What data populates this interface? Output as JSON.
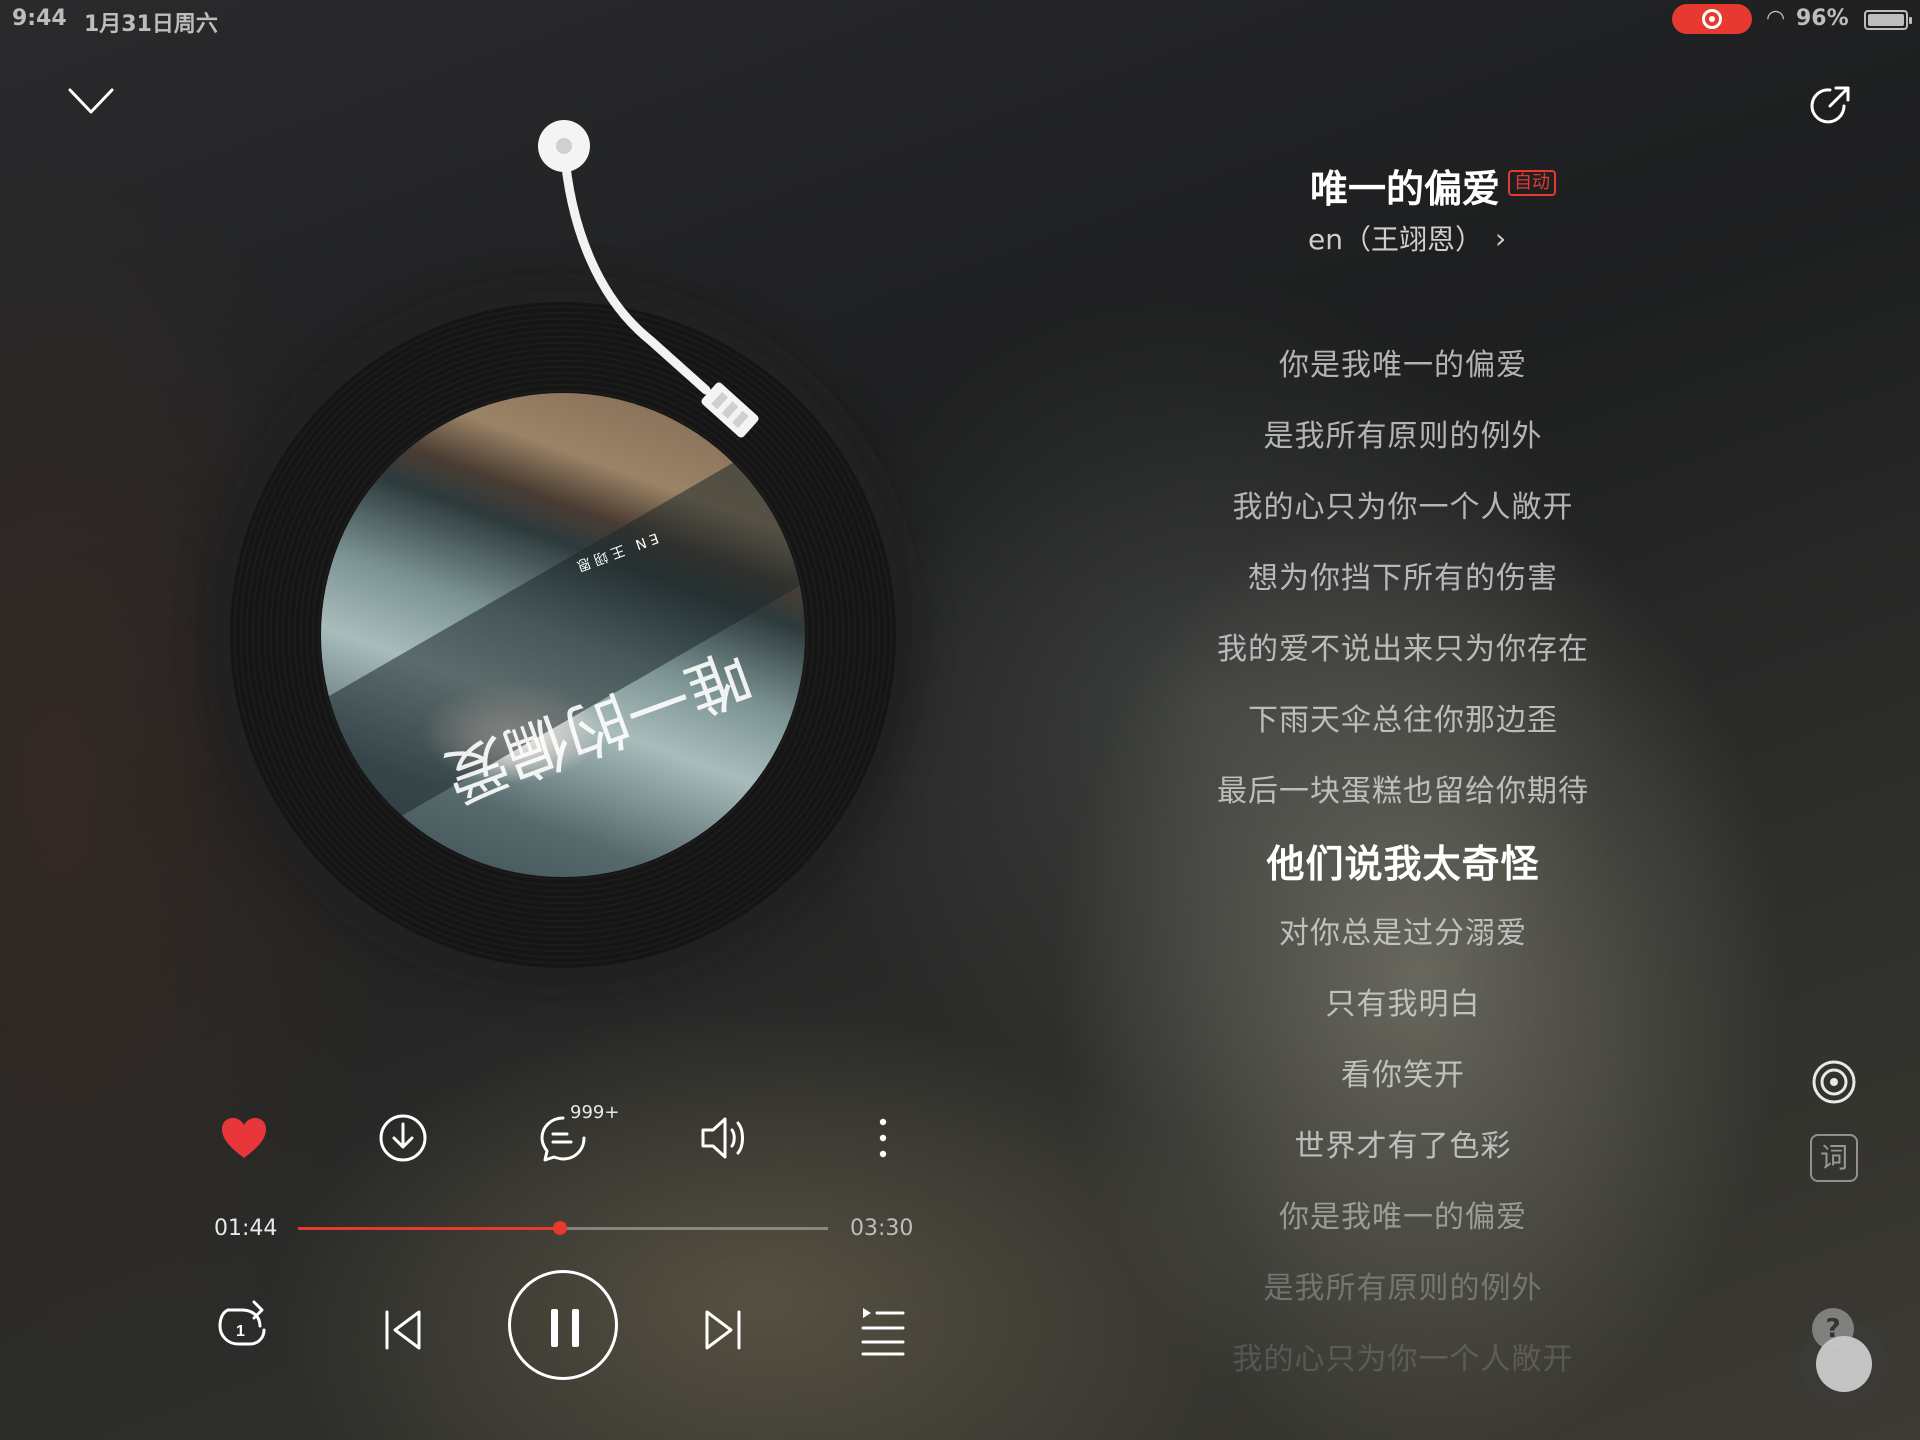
{
  "status_bar": {
    "time": "9:44",
    "date": "1月31日周六",
    "battery": "96%",
    "record_color": "#e63a30"
  },
  "song": {
    "title": "唯一的偏爱",
    "badge": "自动",
    "artist": "en（王翊恩）",
    "chevron": "›"
  },
  "album_art": {
    "title_text": "唯一的偏爱",
    "small_text": "EN 王翊恩"
  },
  "actions": {
    "comment_count": "999+",
    "liked": true,
    "like_color": "#e8363b"
  },
  "progress": {
    "current": "01:44",
    "total": "03:30",
    "fraction": 0.495,
    "color": "#e63a30"
  },
  "lyrics": [
    "你是我唯一的偏爱",
    "是我所有原则的例外",
    "我的心只为你一个人敞开",
    "想为你挡下所有的伤害",
    "我的爱不说出来只为你存在",
    "下雨天伞总往你那边歪",
    "最后一块蛋糕也留给你期待",
    "他们说我太奇怪",
    "对你总是过分溺爱",
    "只有我明白",
    "看你笑开",
    "世界才有了色彩",
    "你是我唯一的偏爱",
    "是我所有原则的例外",
    "我的心只为你一个人敞开"
  ],
  "active_lyric_index": 7,
  "side": {
    "lyric_button": "词",
    "help": "?"
  },
  "icons": [
    "collapse-chevron-icon",
    "share-icon",
    "heart-icon",
    "download-icon",
    "comment-icon",
    "sound-effect-icon",
    "more-icon",
    "repeat-one-icon",
    "previous-icon",
    "pause-icon",
    "next-icon",
    "playlist-icon",
    "vinyl-icon"
  ]
}
